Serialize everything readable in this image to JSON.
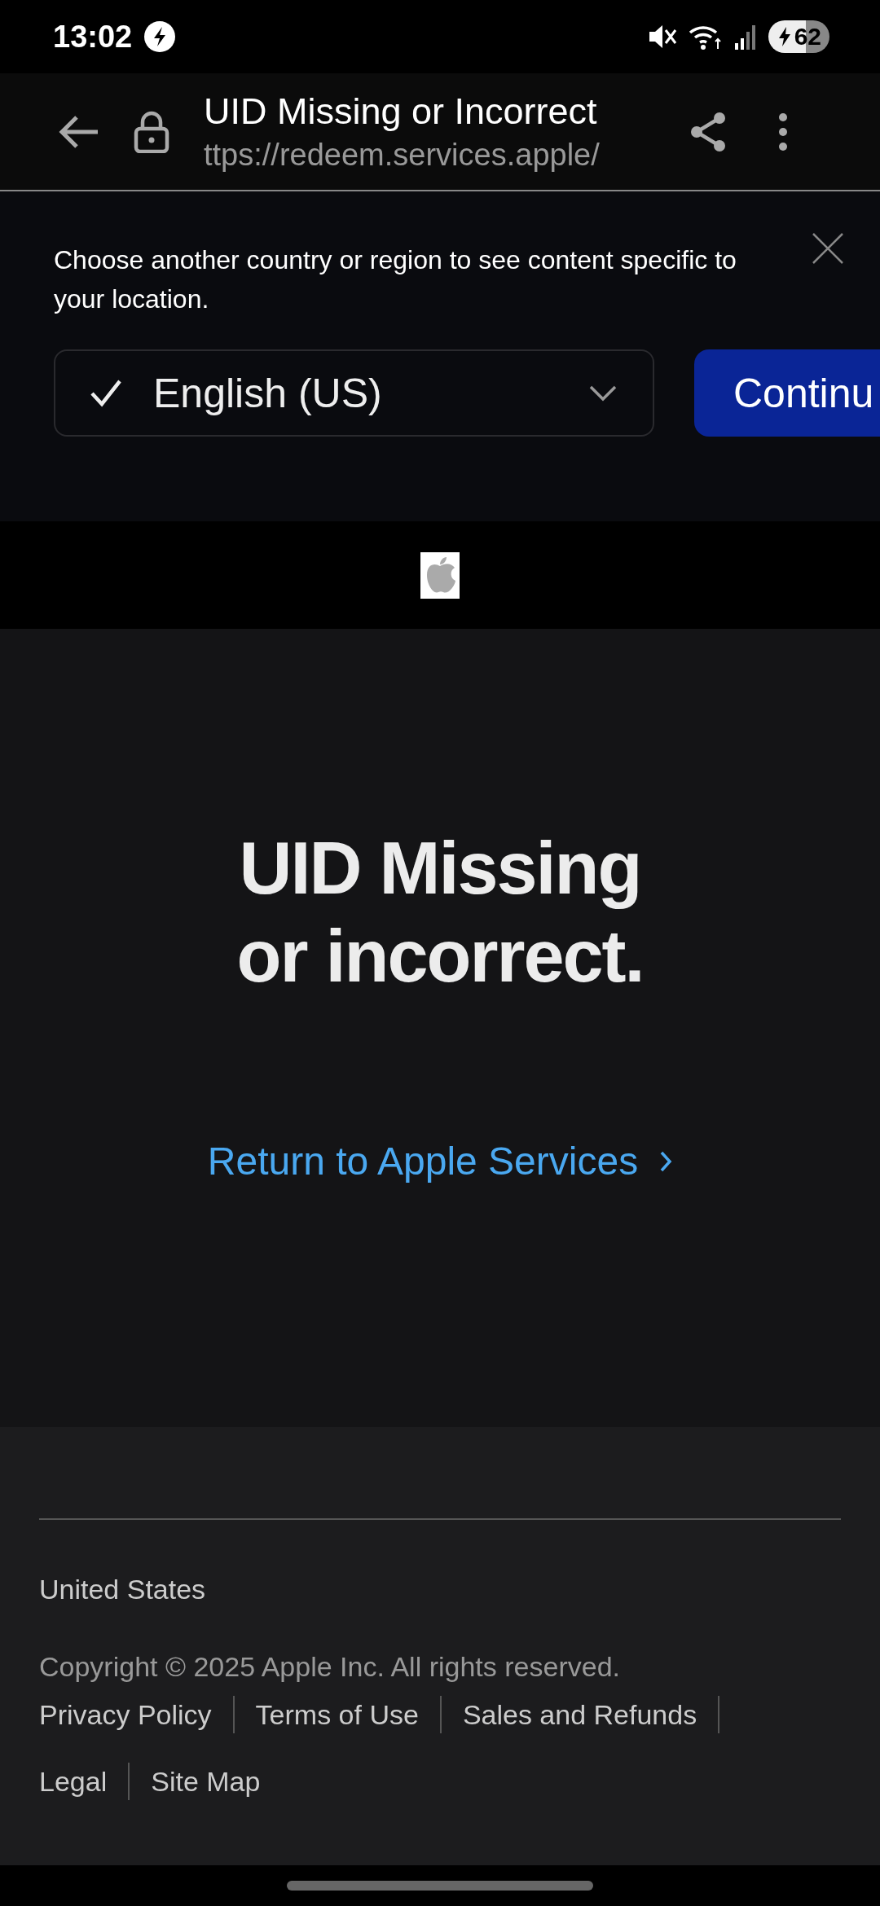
{
  "status_bar": {
    "time": "13:02",
    "battery": "62"
  },
  "browser_bar": {
    "page_title": "UID Missing or Incorrect",
    "url": "ttps://redeem.services.apple/"
  },
  "region_banner": {
    "message": "Choose another country or region to see content specific to your location.",
    "language_select": {
      "value": "English (US)"
    },
    "continue_button": "Continu"
  },
  "main": {
    "heading_lines": [
      "UID Missing",
      "or incorrect."
    ],
    "link": "Return to Apple Services"
  },
  "footer": {
    "country": "United States",
    "copyright": "Copyright © 2025 Apple Inc. All rights reserved.",
    "links": [
      "Privacy Policy",
      "Terms of Use",
      "Sales and Refunds",
      "Legal",
      "Site Map"
    ]
  }
}
